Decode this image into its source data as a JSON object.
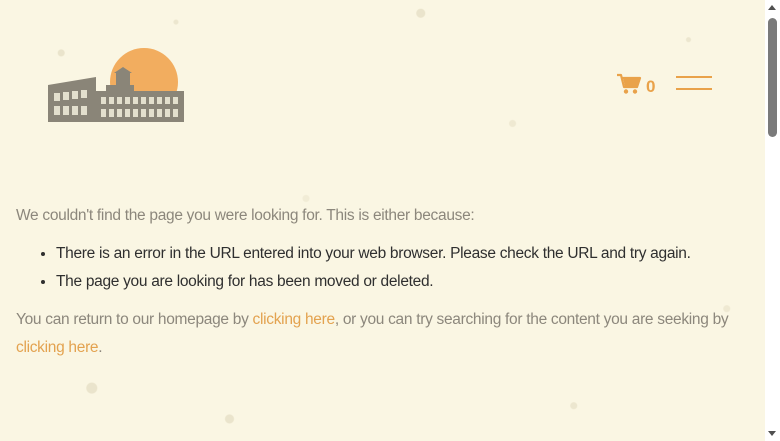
{
  "header": {
    "logo_icon": "warehouse-building-sun-logo-icon",
    "cart": {
      "icon": "shopping-cart-icon",
      "count": "0"
    },
    "menu_icon": "hamburger-menu-icon"
  },
  "content": {
    "intro": "We couldn't find the page you were looking for. This is either because:",
    "reasons": [
      "There is an error in the URL entered into your web browser. Please check the URL and try again.",
      "The page you are looking for has been moved or deleted."
    ],
    "footer": {
      "part1": "You can return to our homepage by ",
      "link1": "clicking here",
      "part2": ", or you can try searching for the content you are seeking by ",
      "link2": "clicking here",
      "part3": "."
    }
  },
  "colors": {
    "background": "#faf6e3",
    "accent": "#e9a24a",
    "muted_text": "#8c877c",
    "body_text": "#2f2f2f"
  }
}
